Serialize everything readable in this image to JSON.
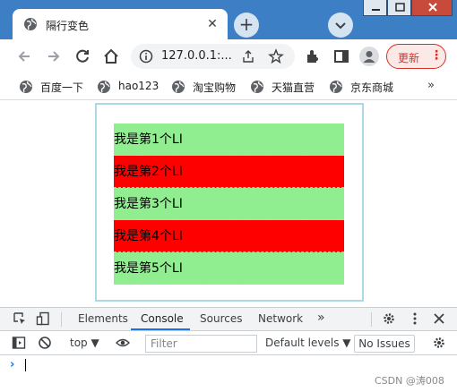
{
  "browser": {
    "tab": {
      "title": "隔行变色",
      "close_glyph": "✕"
    },
    "new_tab_glyph": "+",
    "address": {
      "url": "127.0.0.1:..."
    },
    "update_button": {
      "label": "更新",
      "menu_glyph": "⋮"
    }
  },
  "bookmarks": {
    "items": [
      {
        "label": "百度一下",
        "icon": "globe-icon"
      },
      {
        "label": "hao123",
        "icon": "globe-icon"
      },
      {
        "label": "淘宝购物",
        "icon": "globe-icon"
      },
      {
        "label": "天猫直营",
        "icon": "globe-icon"
      },
      {
        "label": "京东商城",
        "icon": "globe-icon"
      }
    ],
    "more_glyph": "»"
  },
  "page": {
    "list_items": [
      {
        "text": "我是第1个LI",
        "color": "#90ee90"
      },
      {
        "text": "我是第2个LI",
        "color": "#ff0000"
      },
      {
        "text": "我是第3个LI",
        "color": "#90ee90"
      },
      {
        "text": "我是第4个LI",
        "color": "#ff0000"
      },
      {
        "text": "我是第5个LI",
        "color": "#90ee90"
      }
    ],
    "border_color": "#add8e6"
  },
  "devtools": {
    "tabs": [
      {
        "label": "Elements",
        "active": false
      },
      {
        "label": "Console",
        "active": true
      },
      {
        "label": "Sources",
        "active": false
      },
      {
        "label": "Network",
        "active": false
      }
    ],
    "more_tabs_glyph": "»",
    "console": {
      "context": "top ▼",
      "filter_placeholder": "Filter",
      "levels": "Default levels ▼",
      "issues_label": "No Issues",
      "prompt_glyph": "›"
    }
  },
  "watermark": "CSDN @涛008",
  "colors": {
    "accent": "#1a73e8",
    "update_red": "#d93025",
    "titlebar": "#3c7fc4"
  }
}
